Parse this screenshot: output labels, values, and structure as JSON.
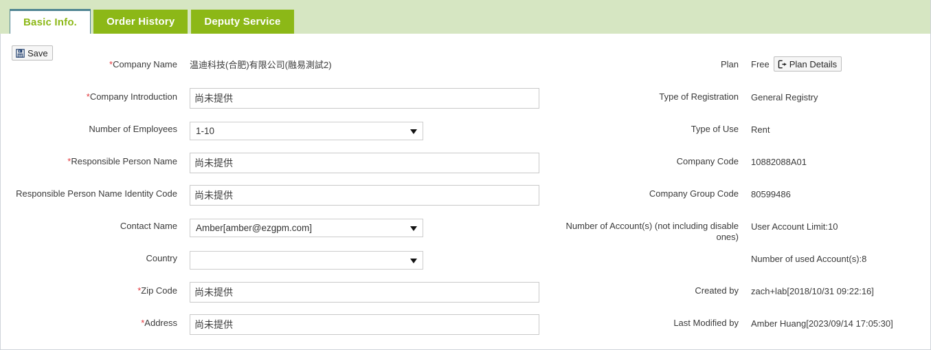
{
  "tabs": [
    {
      "label": "Basic Info.",
      "active": true
    },
    {
      "label": "Order History",
      "active": false
    },
    {
      "label": "Deputy Service",
      "active": false
    }
  ],
  "toolbar": {
    "save_label": "Save",
    "save_icon": "floppy-disk-save-icon"
  },
  "colors": {
    "tab_active_text": "#8cb817",
    "tab_inactive_bg": "#8cb817",
    "tabstrip_bg": "#d6e6c2",
    "tab_active_border": "#4d8391",
    "required_asterisk": "#e2363b",
    "label_text": "#3a3a3a",
    "input_border": "#c8c8c8"
  },
  "left_column": {
    "company_name": {
      "label": "Company Name",
      "required": true,
      "value": "温迪科技(合肥)有限公司(融易測試2)",
      "type": "static"
    },
    "company_introduction": {
      "label": "Company Introduction",
      "required": true,
      "value": "尚未提供",
      "placeholder": "",
      "type": "text"
    },
    "number_of_employees": {
      "label": "Number of Employees",
      "required": false,
      "value": "1-10",
      "type": "select",
      "options": [
        "1-10"
      ]
    },
    "responsible_person_name": {
      "label": "Responsible Person Name",
      "required": true,
      "value": "尚未提供",
      "placeholder": "",
      "type": "text"
    },
    "responsible_person_identity_code": {
      "label": "Responsible Person Name Identity Code",
      "required": false,
      "value": "尚未提供",
      "placeholder": "",
      "type": "text"
    },
    "contact_name": {
      "label": "Contact Name",
      "required": false,
      "value": "Amber[amber@ezgpm.com]",
      "type": "select",
      "options": [
        "Amber[amber@ezgpm.com]"
      ]
    },
    "country": {
      "label": "Country",
      "required": false,
      "value": "",
      "type": "select",
      "options": [
        ""
      ]
    },
    "zip_code": {
      "label": "Zip Code",
      "required": true,
      "value": "尚未提供",
      "placeholder": "",
      "type": "text"
    },
    "address": {
      "label": "Address",
      "required": true,
      "value": "尚未提供",
      "placeholder": "",
      "type": "text"
    }
  },
  "right_column": {
    "plan": {
      "label": "Plan",
      "value": "Free",
      "button_label": "Plan Details",
      "button_icon": "sign-out-external-icon"
    },
    "type_of_registration": {
      "label": "Type of Registration",
      "value": "General Registry"
    },
    "type_of_use": {
      "label": "Type of Use",
      "value": "Rent"
    },
    "company_code": {
      "label": "Company Code",
      "value": "10882088A01"
    },
    "company_group_code": {
      "label": "Company Group Code",
      "value": "80599486"
    },
    "number_of_accounts": {
      "label": "Number of Account(s) (not including disable ones)",
      "value_limit": "User Account Limit:10",
      "value_used": "Number of used Account(s):8"
    },
    "created_by": {
      "label": "Created by",
      "value": "zach+lab[2018/10/31 09:22:16]"
    },
    "last_modified_by": {
      "label": "Last Modified by",
      "value": "Amber Huang[2023/09/14 17:05:30]"
    }
  }
}
